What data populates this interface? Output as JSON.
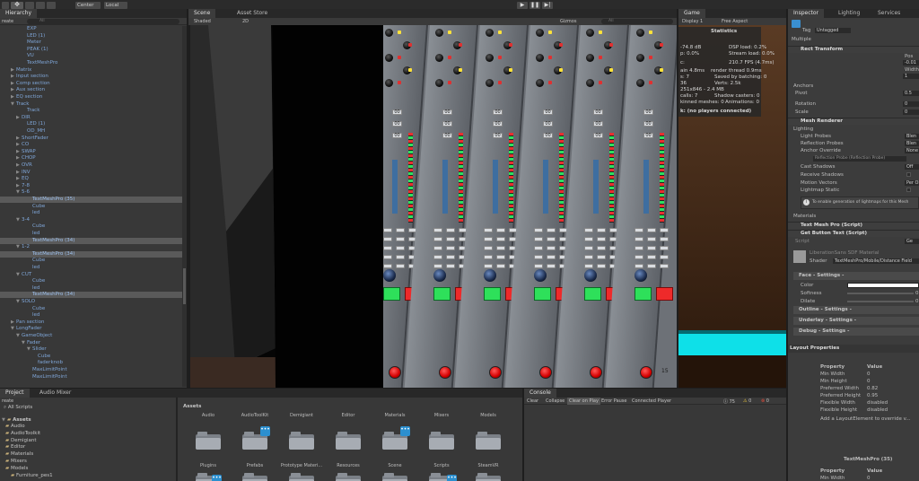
{
  "toolbar": {
    "center_label": "Center",
    "local_label": "Local"
  },
  "hierarchy": {
    "tab": "Hierarchy",
    "create_label": "reate",
    "search_placeholder": "All",
    "rows": [
      {
        "label": "EXP",
        "indent": 4,
        "arrow": "",
        "sel": false
      },
      {
        "label": "LED (1)",
        "indent": 4,
        "arrow": "",
        "sel": false
      },
      {
        "label": "Meter",
        "indent": 4,
        "arrow": "",
        "sel": false
      },
      {
        "label": "PEAK (1)",
        "indent": 4,
        "arrow": "",
        "sel": false
      },
      {
        "label": "VU",
        "indent": 4,
        "arrow": "",
        "sel": false
      },
      {
        "label": "TextMeshPro",
        "indent": 4,
        "arrow": "",
        "sel": false
      },
      {
        "label": "Matrix",
        "indent": 2,
        "arrow": "▶",
        "sel": false
      },
      {
        "label": "Input section",
        "indent": 2,
        "arrow": "▶",
        "sel": false
      },
      {
        "label": "Comp section",
        "indent": 2,
        "arrow": "▶",
        "sel": false
      },
      {
        "label": "Aux section",
        "indent": 2,
        "arrow": "▶",
        "sel": false
      },
      {
        "label": "EQ section",
        "indent": 2,
        "arrow": "▶",
        "sel": false
      },
      {
        "label": "Track",
        "indent": 2,
        "arrow": "▼",
        "sel": false
      },
      {
        "label": "Track",
        "indent": 4,
        "arrow": "",
        "sel": false
      },
      {
        "label": "DIR",
        "indent": 3,
        "arrow": "▶",
        "sel": false
      },
      {
        "label": "LED (1)",
        "indent": 4,
        "arrow": "",
        "sel": false
      },
      {
        "label": "OD_MH",
        "indent": 4,
        "arrow": "",
        "sel": false
      },
      {
        "label": "ShortFader",
        "indent": 3,
        "arrow": "▶",
        "sel": false
      },
      {
        "label": "CO",
        "indent": 3,
        "arrow": "▶",
        "sel": false
      },
      {
        "label": "SWAP",
        "indent": 3,
        "arrow": "▶",
        "sel": false
      },
      {
        "label": "CHOP",
        "indent": 3,
        "arrow": "▶",
        "sel": false
      },
      {
        "label": "OVR",
        "indent": 3,
        "arrow": "▶",
        "sel": false
      },
      {
        "label": "INV",
        "indent": 3,
        "arrow": "▶",
        "sel": false
      },
      {
        "label": "EQ",
        "indent": 3,
        "arrow": "▶",
        "sel": false
      },
      {
        "label": "7-8",
        "indent": 3,
        "arrow": "▶",
        "sel": false
      },
      {
        "label": "5-6",
        "indent": 3,
        "arrow": "▼",
        "sel": false
      },
      {
        "label": "TextMeshPro (35)",
        "indent": 5,
        "arrow": "",
        "sel": true
      },
      {
        "label": "Cube",
        "indent": 5,
        "arrow": "",
        "sel": false
      },
      {
        "label": "led",
        "indent": 5,
        "arrow": "",
        "sel": false
      },
      {
        "label": "3-4",
        "indent": 3,
        "arrow": "▼",
        "sel": false
      },
      {
        "label": "Cube",
        "indent": 5,
        "arrow": "",
        "sel": false
      },
      {
        "label": "led",
        "indent": 5,
        "arrow": "",
        "sel": false
      },
      {
        "label": "TextMeshPro (34)",
        "indent": 5,
        "arrow": "",
        "sel": true
      },
      {
        "label": "1-2",
        "indent": 3,
        "arrow": "▼",
        "sel": false
      },
      {
        "label": "TextMeshPro (34)",
        "indent": 5,
        "arrow": "",
        "sel": true
      },
      {
        "label": "Cube",
        "indent": 5,
        "arrow": "",
        "sel": false
      },
      {
        "label": "led",
        "indent": 5,
        "arrow": "",
        "sel": false
      },
      {
        "label": "CUT",
        "indent": 3,
        "arrow": "▼",
        "sel": false
      },
      {
        "label": "Cube",
        "indent": 5,
        "arrow": "",
        "sel": false
      },
      {
        "label": "led",
        "indent": 5,
        "arrow": "",
        "sel": false
      },
      {
        "label": "TextMeshPro (34)",
        "indent": 5,
        "arrow": "",
        "sel": true
      },
      {
        "label": "SOLO",
        "indent": 3,
        "arrow": "▼",
        "sel": false
      },
      {
        "label": "Cube",
        "indent": 5,
        "arrow": "",
        "sel": false
      },
      {
        "label": "led",
        "indent": 5,
        "arrow": "",
        "sel": false
      },
      {
        "label": "Pan section",
        "indent": 2,
        "arrow": "▶",
        "sel": false
      },
      {
        "label": "LongFader",
        "indent": 2,
        "arrow": "▼",
        "sel": false
      },
      {
        "label": "GameObject",
        "indent": 3,
        "arrow": "▼",
        "sel": false
      },
      {
        "label": "Fader",
        "indent": 4,
        "arrow": "▼",
        "sel": false
      },
      {
        "label": "Slider",
        "indent": 5,
        "arrow": "▼",
        "sel": false
      },
      {
        "label": "Cube",
        "indent": 6,
        "arrow": "",
        "sel": false
      },
      {
        "label": "faderknob",
        "indent": 6,
        "arrow": "",
        "sel": false
      },
      {
        "label": "MaxLimitPoint",
        "indent": 5,
        "arrow": "",
        "sel": false
      },
      {
        "label": "MaxLimitPoint",
        "indent": 5,
        "arrow": "",
        "sel": false
      }
    ]
  },
  "scene": {
    "tab_scene": "Scene",
    "tab_asset_store": "Asset Store",
    "shaded_label": "Shaded",
    "mode_2d": "2D",
    "gizmos_label": "Gizmos",
    "search_placeholder": "All"
  },
  "game": {
    "tab": "Game",
    "display_label": "Display 1",
    "aspect_label": "Free Aspect",
    "stats_title": "Statistics",
    "stats_lines": [
      "-74.8 dB",
      "p: 0.0%",
      "DSP load: 0.2%",
      "Stream load: 0.0%",
      "c:",
      "210.7 FPS (4.7ms)",
      "ain 4.8ms",
      "render thread 0.9ms",
      "s: 7",
      "Saved by batching: 0",
      "36",
      "Verts: 2.5k",
      "251x846 - 2.4 MB",
      "calls: 7",
      "Shadow casters: 0",
      "kinned meshes: 0",
      "Animations: 0",
      "k: (no players connected)"
    ]
  },
  "inspector": {
    "tab_inspector": "Inspector",
    "tab_lighting": "Lighting",
    "tab_services": "Services",
    "tag_label": "Tag",
    "tag_value": "Untagged",
    "multiple_label": "Multiple",
    "rect_transform": "Rect Transform",
    "pos_label": "Pos",
    "pos_value": "-0.01",
    "width_label": "Width",
    "width_value": "1",
    "anchors": "Anchors",
    "pivot": "Pivot",
    "pivot_value": "0.5",
    "rotation": "Rotation",
    "rotation_value": "0",
    "scale": "Scale",
    "scale_value": "0",
    "mesh_renderer": "Mesh Renderer",
    "lighting": "Lighting",
    "light_probes": "Light Probes",
    "light_probes_value": "Blen",
    "reflection_probes": "Reflection Probes",
    "reflection_probes_value": "Blen",
    "anchor_override": "Anchor Override",
    "anchor_override_value": "None",
    "reflection_probe_note": "Reflection Probe (Reflection Probe)",
    "cast_shadows": "Cast Shadows",
    "cast_shadows_value": "Off",
    "receive_shadows": "Receive Shadows",
    "motion_vectors": "Motion Vectors",
    "motion_vectors_value": "Per Ob",
    "lightmap_static": "Lightmap Static",
    "lightmap_note": "To enable generation of lightmaps for this Mesh",
    "materials": "Materials",
    "tmp_script": "Text Mesh Pro (Script)",
    "get_button_script": "Get Button Text (Script)",
    "script_label": "Script",
    "script_value": "Ge",
    "material_name": "LiberationSans SDF Material",
    "shader_label": "Shader",
    "shader_value": "TextMeshPro/Mobile/Distance Field",
    "face_settings": "Face - Settings -",
    "color_label": "Color",
    "softness_label": "Softness",
    "softness_value": "0",
    "dilate_label": "Dilate",
    "dilate_value": "0",
    "outline_settings": "Outline - Settings -",
    "underlay_settings": "Underlay - Settings -",
    "debug_settings": "Debug - Settings -",
    "layout_properties": "Layout Properties",
    "prop_head_property": "Property",
    "prop_head_value": "Value",
    "props": [
      {
        "name": "Min Width",
        "value": "0"
      },
      {
        "name": "Min Height",
        "value": "0"
      },
      {
        "name": "Preferred Width",
        "value": "0.82"
      },
      {
        "name": "Preferred Height",
        "value": "0.95"
      },
      {
        "name": "Flexible Width",
        "value": "disabled"
      },
      {
        "name": "Flexible Height",
        "value": "disabled"
      }
    ],
    "add_layout_note": "Add a LayoutElement to override v...",
    "tmp_title": "TextMeshPro (35)",
    "props2": [
      {
        "name": "Min Width",
        "value": "0"
      }
    ]
  },
  "project": {
    "tab_project": "Project",
    "tab_audio_mixer": "Audio Mixer",
    "create_label": "reate",
    "all_scripts": "All Scripts",
    "assets_root": "Assets",
    "tree": [
      "Audio",
      "AudioToolkit",
      "Demigiant",
      "Editor",
      "Materials",
      "Mixers",
      "Models",
      "Furniture_pes1"
    ],
    "breadcrumb": "Assets",
    "folders_row1": [
      {
        "label": "Audio",
        "badge": false
      },
      {
        "label": "AudioToolKit",
        "badge": true
      },
      {
        "label": "Demigiant",
        "badge": false
      },
      {
        "label": "Editor",
        "badge": false
      },
      {
        "label": "Materials",
        "badge": true
      },
      {
        "label": "Mixers",
        "badge": false
      },
      {
        "label": "Models",
        "badge": false
      }
    ],
    "folders_row2": [
      {
        "label": "Plugins",
        "badge": false
      },
      {
        "label": "Prefabs",
        "badge": false
      },
      {
        "label": "Prototype Materi...",
        "badge": false
      },
      {
        "label": "Resources",
        "badge": false
      },
      {
        "label": "Scene",
        "badge": false
      },
      {
        "label": "Scripts",
        "badge": false
      },
      {
        "label": "SteamVR",
        "badge": false
      }
    ]
  },
  "console": {
    "tab": "Console",
    "buttons": [
      "Clear",
      "Collapse",
      "Clear on Play",
      "Error Pause",
      "Connected Player"
    ],
    "count_a": "75",
    "count_b": "0",
    "count_c": "0"
  },
  "mixer": {
    "strips": [
      {
        "numbers": [
          "00",
          "00",
          "00"
        ],
        "label": "10"
      },
      {
        "numbers": [
          "00",
          "00",
          "00"
        ],
        "label": "15"
      },
      {
        "numbers": [
          "00",
          "00",
          "00"
        ],
        "label": "10"
      },
      {
        "numbers": [
          "00",
          "00",
          "00"
        ],
        "label": "15"
      },
      {
        "numbers": [
          "00",
          "00",
          "00"
        ],
        "label": "10"
      },
      {
        "numbers": [
          "00",
          "00",
          "00"
        ],
        "label": "15"
      }
    ],
    "bottom_labels": [
      "10",
      "15",
      "15",
      "15"
    ]
  }
}
